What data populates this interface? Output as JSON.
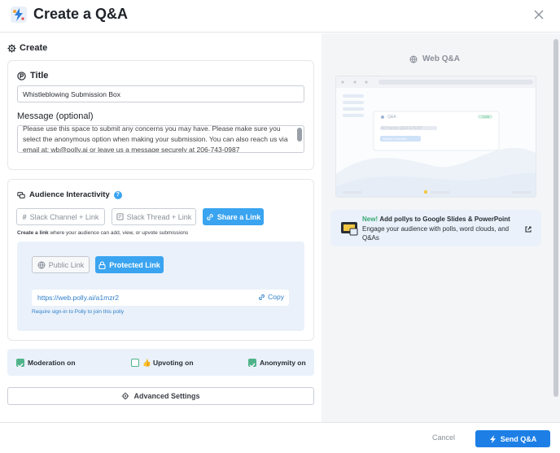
{
  "header": {
    "title": "Create a Q&A"
  },
  "create": {
    "section_title": "Create"
  },
  "title_field": {
    "label": "Title",
    "value": "Whistleblowing Submission Box"
  },
  "message_field": {
    "label": "Message (optional)",
    "value": "Please use this space to submit any concerns you may have. Please make sure you select the anonymous option when making your submission. You can also reach us via email at: wb@polly.ai or leave us a message securely at 206-743-0987"
  },
  "audience": {
    "label": "Audience Interactivity",
    "buttons": {
      "slack_channel": "Slack Channel + Link",
      "slack_thread": "Slack Thread + Link",
      "share_link": "Share a Link"
    },
    "hint_bold": "Create a link",
    "hint_rest": " where your audience can add, view, or upvote submissions"
  },
  "link": {
    "public": "Public Link",
    "protected": "Protected Link",
    "url": "https://web.polly.ai/a1mzr2",
    "copy": "Copy",
    "note": "Require sign-in to Polly to join this polly"
  },
  "toggles": {
    "moderation": {
      "label": "Moderation on",
      "checked": true
    },
    "upvoting": {
      "label": "👍 Upvoting on",
      "checked": false
    },
    "anonymity": {
      "label": "Anonymity on",
      "checked": true
    }
  },
  "advanced": {
    "label": "Advanced Settings"
  },
  "footer": {
    "cancel": "Cancel",
    "send": "Send Q&A"
  },
  "preview": {
    "title": "Web Q&A",
    "mock_card_title": "Q&A",
    "mock_status": "Live",
    "mock_heading": "All Hands Q&A EVENT",
    "mock_button": "Submit a Question"
  },
  "promo": {
    "new_label": "New!",
    "line1": "Add pollys to Google Slides & PowerPoint",
    "line2": "Engage your audience with polls, word clouds, and Q&As"
  },
  "colors": {
    "accent": "#3aa4f0",
    "primary": "#1d7fe6",
    "success": "#4fb38a"
  }
}
